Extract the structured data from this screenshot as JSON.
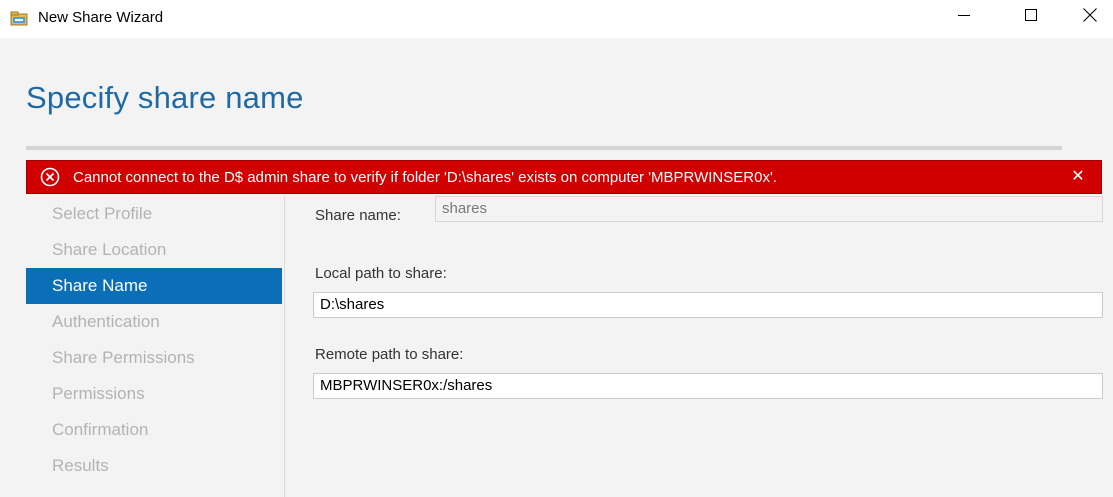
{
  "window": {
    "title": "New Share Wizard",
    "icon": "share-folder-icon",
    "controls": [
      "minimize-icon",
      "maximize-icon",
      "close-icon"
    ]
  },
  "page": {
    "heading": "Specify share name"
  },
  "error": {
    "icon": "error-circle-icon",
    "message": "Cannot connect to the D$ admin share to verify if folder 'D:\\shares' exists on computer 'MBPRWINSER0x'.",
    "close_label": "✕"
  },
  "nav": {
    "items": [
      {
        "label": "Select Profile",
        "active": false
      },
      {
        "label": "Share Location",
        "active": false
      },
      {
        "label": "Share Name",
        "active": true
      },
      {
        "label": "Authentication",
        "active": false
      },
      {
        "label": "Share Permissions",
        "active": false
      },
      {
        "label": "Permissions",
        "active": false
      },
      {
        "label": "Confirmation",
        "active": false
      },
      {
        "label": "Results",
        "active": false
      }
    ]
  },
  "form": {
    "share_name_label": "Share name:",
    "share_name_value": "shares",
    "local_path_label": "Local path to share:",
    "local_path_value": "D:\\shares",
    "remote_path_label": "Remote path to share:",
    "remote_path_value": "MBPRWINSER0x:/shares"
  },
  "colors": {
    "accent": "#0b6fb8",
    "heading": "#1f6aa5",
    "error": "#d10000"
  }
}
